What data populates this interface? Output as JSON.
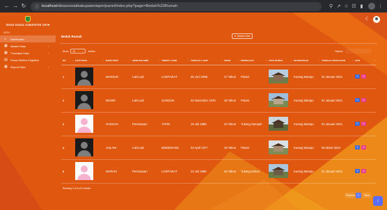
{
  "browser": {
    "url_host": "localhost",
    "url_path": "/dinassosialkabupatentapin/panel/index.php?page=Bedah%20Rumah",
    "icons": [
      "back-icon",
      "forward-icon",
      "reload-icon",
      "zoom-icon",
      "share-icon",
      "bookmark-icon",
      "extensions-icon",
      "sidebar-icon",
      "profile-icon",
      "menu-icon"
    ]
  },
  "sidebar": {
    "brand_title": "DINAS SOSIAL KABUPATEN TAPIN",
    "section_label": "MENU",
    "items": [
      {
        "label": "Dashboard",
        "icon": "home-icon",
        "has_submenu": false,
        "active": true
      },
      {
        "label": "Master Data",
        "icon": "grid-icon",
        "has_submenu": true,
        "active": false
      },
      {
        "label": "Transaksi Data",
        "icon": "grid-icon",
        "has_submenu": true,
        "active": false
      },
      {
        "label": "Posisi Sistem Kegiatan",
        "icon": "document-icon",
        "has_submenu": false,
        "active": false
      },
      {
        "label": "Report Data",
        "icon": "grid-icon",
        "has_submenu": true,
        "active": false
      }
    ]
  },
  "topbar": {
    "theme_icon": "moon-icon",
    "avatar_icon": "user-avatar-icon"
  },
  "card": {
    "title": "Bedah Rumah",
    "add_button_label": "⊕ Tambah Data",
    "show_label": "Show",
    "show_value": "10",
    "entries_label": "entries",
    "search_label": "Search:"
  },
  "table": {
    "headers": [
      "NO",
      "FOTO PPKS",
      "NAMA PPKS",
      "JENIS KELAMIN",
      "TEMPAT LAHIR",
      "TANGGAL LAHIR",
      "UMUR",
      "PEKERJAAN",
      "FOTO RUMAH",
      "KETERANGAN",
      "TANGGAL PENGAJUAN",
      "AKSI"
    ],
    "rows": [
      {
        "no": "1",
        "avatar": "dark",
        "nama": "MANSUR",
        "jk": "Laki-Laki",
        "tempat": "LOKPAIKAT",
        "tgl": "05 Juni 1996",
        "umur": "27 Tahun",
        "kerja": "Petani",
        "rumah": "house-1",
        "ket": "Kurang Mampu",
        "pengajuan": "01 Januari 2021"
      },
      {
        "no": "2",
        "avatar": "dark",
        "nama": "MUHRI",
        "jk": "Laki-Laki",
        "tempat": "SUNGUN",
        "tgl": "04 November 1976",
        "umur": "46 Tahun",
        "kerja": "Petani",
        "rumah": "house-2",
        "ket": "Kurang Mampu",
        "pengajuan": "01 Januari 2021"
      },
      {
        "no": "3",
        "avatar": "light",
        "nama": "HADIJAH",
        "jk": "Perempuan",
        "tempat": "TAPIN",
        "tgl": "19 Juli 1988",
        "umur": "34 Tahun",
        "kerja": "Tukang Sampah",
        "rumah": "house-3",
        "ket": "Kurang Mampu",
        "pengajuan": "01 Januari 2021"
      },
      {
        "no": "4",
        "avatar": "dark",
        "nama": "JAILANI",
        "jk": "Laki-Laki",
        "tempat": "BINDERANG",
        "tgl": "03 April 1977",
        "umur": "46 Tahun",
        "kerja": "Petani",
        "rumah": "house-4",
        "ket": "Kurang Mampu",
        "pengajuan": "06 Maret 2022"
      },
      {
        "no": "5",
        "avatar": "light",
        "nama": "MARIAH",
        "jk": "Perempuan",
        "tempat": "LOKPAIKAT",
        "tgl": "22 Juli 1986",
        "umur": "35 Tahun",
        "kerja": "Tukang Kebun",
        "rumah": "house-5",
        "ket": "Kurang Mampu",
        "pengajuan": "01 Januari 2021"
      }
    ],
    "actions": {
      "edit_icon": "edit-icon",
      "delete_icon": "trash-icon"
    }
  },
  "footer": {
    "info_text": "Showing 1 to 5 of 5 entries",
    "prev_label": "Previous",
    "current_page": "1",
    "next_label": "Next"
  },
  "fab_icon": "arrow-up-icon",
  "colors": {
    "background": "#e0570f",
    "accent_blue": "#5b6cf6",
    "edit_button": "#3f6ad8",
    "delete_button": "#e83e8c"
  }
}
